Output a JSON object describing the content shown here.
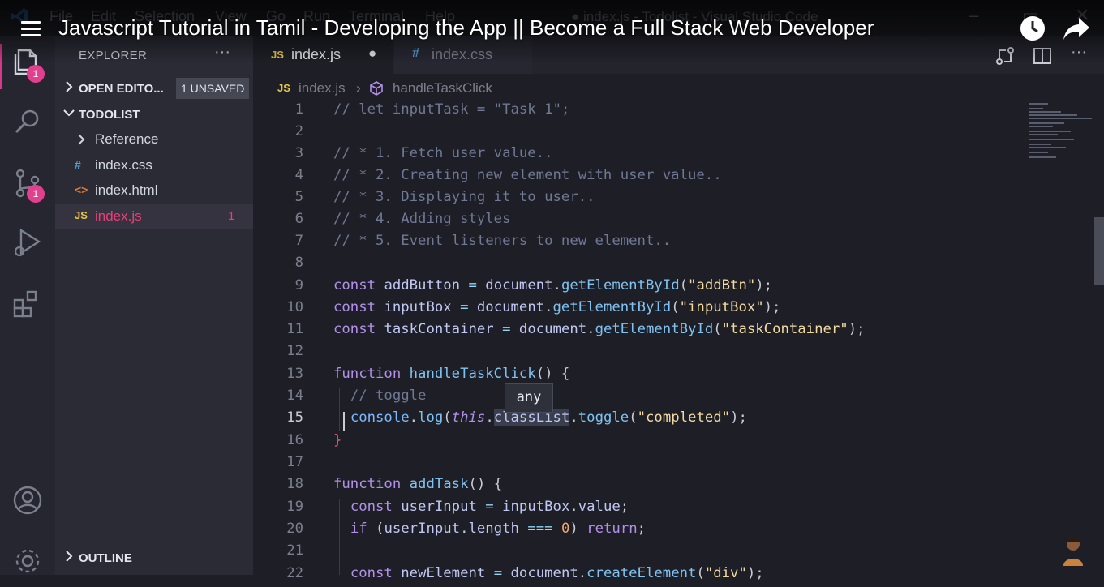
{
  "window": {
    "menu": [
      "File",
      "Edit",
      "Selection",
      "View",
      "Go",
      "Run",
      "Terminal",
      "Help"
    ],
    "title": "● index.js - Todolist - Visual Studio Code"
  },
  "video": {
    "title": "Javascript Tutorial in Tamil - Developing the App || Become a Full Stack Web Developer"
  },
  "activity_bar": {
    "explorer_badge": "1",
    "scm_badge": "1"
  },
  "sidebar": {
    "header": "EXPLORER",
    "more": "···",
    "open_editors": "OPEN EDITO...",
    "unsaved": "1 UNSAVED",
    "folder": "TODOLIST",
    "files": [
      {
        "icon": "›",
        "name": "Reference"
      },
      {
        "icon": "#",
        "name": "index.css"
      },
      {
        "icon": "<>",
        "name": "index.html"
      },
      {
        "icon": "JS",
        "name": "index.js",
        "count": "1"
      }
    ],
    "outline": "OUTLINE"
  },
  "tabs": [
    {
      "icon": "JS",
      "label": "index.js",
      "modified": "●"
    },
    {
      "icon": "#",
      "label": "index.css"
    }
  ],
  "breadcrumb": {
    "file_icon": "JS",
    "file": "index.js",
    "separator": "›",
    "symbol": "handleTaskClick"
  },
  "hover": "any",
  "line_numbers": [
    "1",
    "2",
    "3",
    "4",
    "5",
    "6",
    "7",
    "8",
    "9",
    "10",
    "11",
    "12",
    "13",
    "14",
    "15",
    "16",
    "17",
    "18",
    "19",
    "20",
    "21",
    "22"
  ],
  "colors": {
    "accent": "#e0418f",
    "keyword": "#b390e8",
    "function": "#7fc2f2",
    "string": "#f2d9a0",
    "comment": "#6f7894"
  }
}
